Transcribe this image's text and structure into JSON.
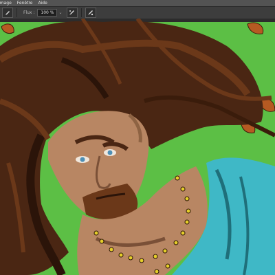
{
  "menu": {
    "items": [
      "Image",
      "Fenêtre",
      "Aide"
    ]
  },
  "options": {
    "flow_label": "Flux :",
    "flow_value": "100 %",
    "dropdown_glyph": "⌄",
    "brush_icon": "brush-icon",
    "airbrush_icon": "airbrush-icon",
    "pressure_icon": "pressure-icon"
  },
  "colors": {
    "menubar": "#535353",
    "optionsbar": "#3d3d3d",
    "hair": "#4a2613",
    "skin": "#b88663",
    "background_green": "#5cbf45",
    "shirt_blue": "#3fb8c6",
    "beads": "#e6cf2a"
  }
}
